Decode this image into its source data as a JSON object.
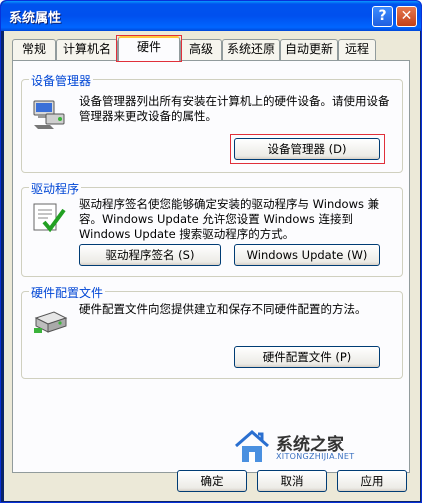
{
  "window": {
    "title": "系统属性",
    "help_button": "?",
    "close_button": "✕"
  },
  "tabs": [
    {
      "label": "常规"
    },
    {
      "label": "计算机名"
    },
    {
      "label": "硬件",
      "selected": true
    },
    {
      "label": "高级"
    },
    {
      "label": "系统还原"
    },
    {
      "label": "自动更新"
    },
    {
      "label": "远程"
    }
  ],
  "groups": {
    "device_manager": {
      "title": "设备管理器",
      "description": "设备管理器列出所有安装在计算机上的硬件设备。请使用设备管理器来更改设备的属性。",
      "button": "设备管理器 (D)",
      "icon": "device-manager-icon"
    },
    "drivers": {
      "title": "驱动程序",
      "description": "驱动程序签名使您能够确定安装的驱动程序与 Windows 兼容。Windows Update 允许您设置 Windows 连接到 Windows Update 搜索驱动程序的方式。",
      "button_signing": "驱动程序签名 (S)",
      "button_update": "Windows Update (W)",
      "icon": "driver-signing-icon"
    },
    "hardware_profiles": {
      "title": "硬件配置文件",
      "description": "硬件配置文件向您提供建立和保存不同硬件配置的方法。",
      "button": "硬件配置文件 (P)",
      "icon": "hardware-profile-icon"
    }
  },
  "footer": {
    "ok": "确定",
    "cancel": "取消",
    "apply": "应用"
  },
  "watermark": {
    "brand": "系统之家",
    "url": "XITONGZHIJIA.NET"
  },
  "colors": {
    "title_bar": "#0054e3",
    "group_title": "#0046d5",
    "highlight_box": "#e0303a",
    "dialog_face": "#ece9d8"
  }
}
